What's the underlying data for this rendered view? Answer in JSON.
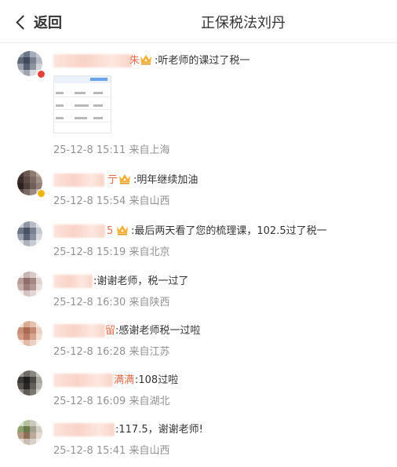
{
  "header": {
    "back_label": "返回",
    "title": "正保税法刘丹"
  },
  "comments": [
    {
      "name_tail": "朱",
      "text": ":听老师的课过了税一",
      "meta": "25-12-8 15:11 来自上海"
    },
    {
      "name_tail": "亍",
      "text": ":明年继续加油",
      "meta": "25-12-8 15:54 来自山西"
    },
    {
      "name_tail": "5",
      "text": ":最后两天看了您的梳理课，102.5过了税一",
      "meta": "25-12-8 15:19 来自北京"
    },
    {
      "name_tail": "",
      "text": ":谢谢老师，税一过了",
      "meta": "25-12-8 16:30 来自陕西"
    },
    {
      "name_tail": "留",
      "text": ":感谢老师税一过啦",
      "meta": "25-12-8 16:28 来自江苏"
    },
    {
      "name_tail": "满满",
      "text": ":108过啦",
      "meta": "25-12-8 16:09 来自湖北"
    },
    {
      "name_tail": "",
      "text": ":117.5，谢谢老师!",
      "meta": "25-12-8 15:41 来自山西"
    }
  ],
  "colors": {
    "accent": "#f39a2d",
    "meta": "#939393",
    "name_tail": "#e36c4d",
    "badge_red": "#e2423c",
    "badge_gold": "#f1b400"
  }
}
